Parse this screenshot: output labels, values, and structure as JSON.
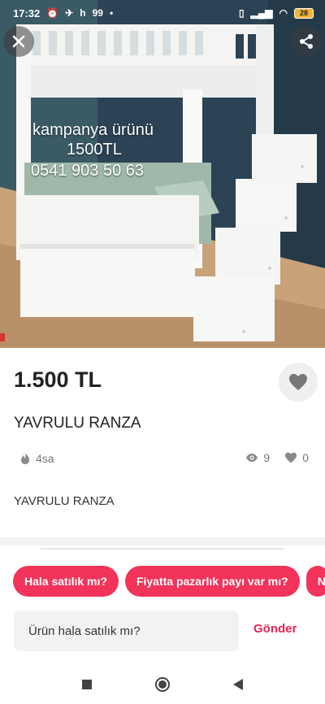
{
  "status_bar": {
    "time": "17:32",
    "notif_h": "h",
    "notif_99": "99",
    "battery": "28"
  },
  "listing": {
    "photo_overlay": {
      "line1": "kampanya ürünü",
      "line2": "1500TL",
      "line3": "0541 903 50 63"
    },
    "price": "1.500 TL",
    "title": "YAVRULU RANZA",
    "posted_ago": "4sa",
    "view_count": "9",
    "like_count": "0",
    "description": "YAVRULU RANZA"
  },
  "quick_replies": [
    {
      "label": "Hala satılık mı?"
    },
    {
      "label": "Fiyatta pazarlık payı var mı?"
    },
    {
      "label": "N"
    }
  ],
  "message": {
    "input_value": "Ürün hala satılık mı?",
    "send_label": "Gönder"
  },
  "colors": {
    "accent": "#f2345a",
    "send": "#e8244f"
  },
  "icons": [
    "close-icon",
    "share-icon",
    "heart-icon",
    "fire-icon",
    "eye-icon",
    "nav-back-icon",
    "nav-home-icon",
    "nav-recents-icon"
  ]
}
